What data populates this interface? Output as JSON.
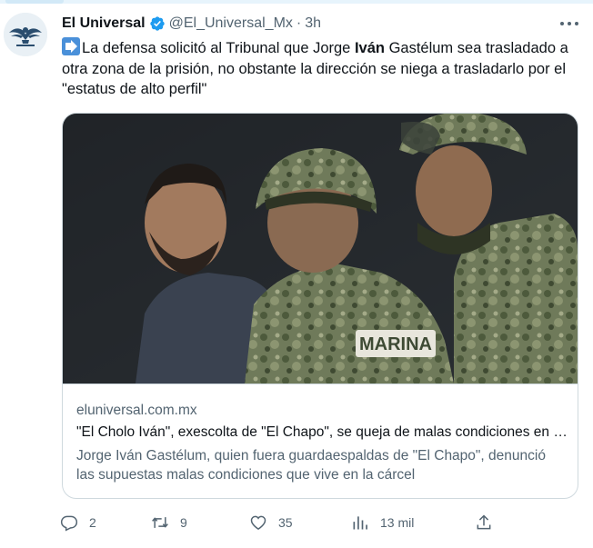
{
  "author": {
    "name": "El Universal",
    "handle": "@El_Universal_Mx",
    "separator": "·",
    "time": "3h",
    "verified_badge_icon": "verified-badge-icon",
    "badge_color": "#1d9bf0"
  },
  "tweet": {
    "text_before": "La defensa solicitó al Tribunal que Jorge ",
    "text_bold": "Iván",
    "text_after": " Gastélum sea trasladado a otra zona de la prisión, no obstante la dirección se niega a trasladarlo por el \"estatus de alto perfil\"",
    "leading_icon": "right-arrow-emoji-icon"
  },
  "card": {
    "domain": "eluniversal.com.mx",
    "title": "\"El Cholo Iván\", exescolta de \"El Chapo\", se queja de malas condiciones en la cárcel",
    "description": "Jorge Iván Gastélum, quien fuera guardaespaldas de \"El Chapo\", denunció las supuestas malas condiciones que vive en la cárcel",
    "image_icon": "news-photo"
  },
  "actions": {
    "replies": "2",
    "reposts": "9",
    "likes": "35",
    "views": "13 mil",
    "reply_icon": "reply-icon",
    "repost_icon": "repost-icon",
    "like_icon": "heart-icon",
    "views_icon": "views-chart-icon",
    "share_icon": "share-icon"
  },
  "colors": {
    "text": "#0f1419",
    "secondary": "#536471",
    "border": "#cfd9de",
    "accent": "#1d9bf0"
  }
}
